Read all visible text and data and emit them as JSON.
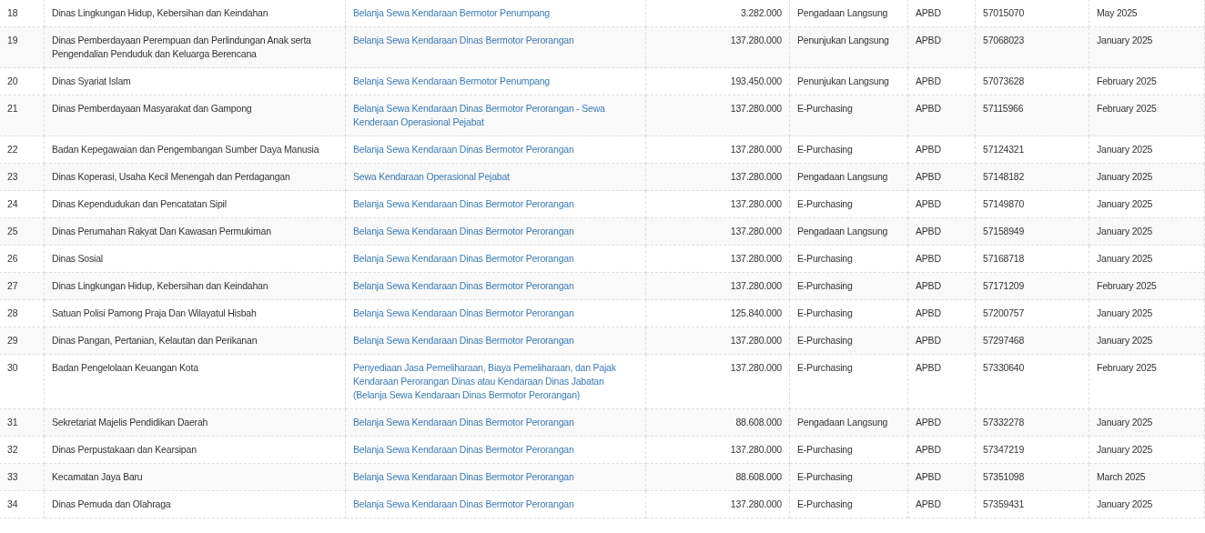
{
  "table": {
    "rows": [
      {
        "no": "18",
        "unit": "Dinas Lingkungan Hidup, Kebersihan dan Keindahan",
        "package": "Belanja Sewa Kendaraan Bermotor Penumpang",
        "budget": "3.282.000",
        "method": "Pengadaan Langsung",
        "source": "APBD",
        "code": "57015070",
        "time": "May 2025"
      },
      {
        "no": "19",
        "unit": "Dinas Pemberdayaan Perempuan dan Perlindungan Anak serta Pengendalian Penduduk dan Keluarga Berencana",
        "package": "Belanja Sewa Kendaraan Dinas Bermotor Perorangan",
        "budget": "137.280.000",
        "method": "Penunjukan Langsung",
        "source": "APBD",
        "code": "57068023",
        "time": "January 2025"
      },
      {
        "no": "20",
        "unit": "Dinas Syariat Islam",
        "package": "Belanja Sewa Kendaraan Bermotor Penumpang",
        "budget": "193.450.000",
        "method": "Penunjukan Langsung",
        "source": "APBD",
        "code": "57073628",
        "time": "February 2025"
      },
      {
        "no": "21",
        "unit": "Dinas Pemberdayaan Masyarakat dan Gampong",
        "package": "Belanja Sewa Kendaraan Dinas Bermotor Perorangan - Sewa Kenderaan Operasional Pejabat",
        "budget": "137.280.000",
        "method": "E-Purchasing",
        "source": "APBD",
        "code": "57115966",
        "time": "February 2025"
      },
      {
        "no": "22",
        "unit": "Badan Kepegawaian dan Pengembangan Sumber Daya Manusia",
        "package": "Belanja Sewa Kendaraan Dinas Bermotor Perorangan",
        "budget": "137.280.000",
        "method": "E-Purchasing",
        "source": "APBD",
        "code": "57124321",
        "time": "January 2025"
      },
      {
        "no": "23",
        "unit": "Dinas Koperasi, Usaha Kecil Menengah dan Perdagangan",
        "package": "Sewa Kendaraan Operasional Pejabat",
        "budget": "137.280.000",
        "method": "Pengadaan Langsung",
        "source": "APBD",
        "code": "57148182",
        "time": "January 2025"
      },
      {
        "no": "24",
        "unit": "Dinas Kependudukan dan Pencatatan Sipil",
        "package": "Belanja Sewa Kendaraan Dinas Bermotor Perorangan",
        "budget": "137.280.000",
        "method": "E-Purchasing",
        "source": "APBD",
        "code": "57149870",
        "time": "January 2025"
      },
      {
        "no": "25",
        "unit": "Dinas Perumahan Rakyat Dan Kawasan Permukiman",
        "package": "Belanja Sewa Kendaraan Dinas Bermotor Perorangan",
        "budget": "137.280.000",
        "method": "Pengadaan Langsung",
        "source": "APBD",
        "code": "57158949",
        "time": "January 2025"
      },
      {
        "no": "26",
        "unit": "Dinas Sosial",
        "package": "Belanja Sewa Kendaraan Dinas Bermotor Perorangan",
        "budget": "137.280.000",
        "method": "E-Purchasing",
        "source": "APBD",
        "code": "57168718",
        "time": "January 2025"
      },
      {
        "no": "27",
        "unit": "Dinas Lingkungan Hidup, Kebersihan dan Keindahan",
        "package": "Belanja Sewa Kendaraan Dinas Bermotor Perorangan",
        "budget": "137.280.000",
        "method": "E-Purchasing",
        "source": "APBD",
        "code": "57171209",
        "time": "February 2025"
      },
      {
        "no": "28",
        "unit": "Satuan Polisi Pamong Praja Dan Wilayatul Hisbah",
        "package": "Belanja Sewa Kendaraan Dinas Bermotor Perorangan",
        "budget": "125.840.000",
        "method": "E-Purchasing",
        "source": "APBD",
        "code": "57200757",
        "time": "January 2025"
      },
      {
        "no": "29",
        "unit": "Dinas Pangan, Pertanian, Kelautan dan Perikanan",
        "package": "Belanja Sewa Kendaraan Dinas Bermotor Perorangan",
        "budget": "137.280.000",
        "method": "E-Purchasing",
        "source": "APBD",
        "code": "57297468",
        "time": "January 2025"
      },
      {
        "no": "30",
        "unit": "Badan Pengelolaan Keuangan Kota",
        "package": "Penyediaan Jasa Pemeliharaan, Biaya Pemeliharaan, dan Pajak Kendaraan Perorangan Dinas atau Kendaraan Dinas Jabatan (Belanja Sewa Kendaraan Dinas Bermotor Perorangan)",
        "budget": "137.280.000",
        "method": "E-Purchasing",
        "source": "APBD",
        "code": "57330640",
        "time": "February 2025"
      },
      {
        "no": "31",
        "unit": "Sekretariat Majelis Pendidikan Daerah",
        "package": "Belanja Sewa Kendaraan Dinas Bermotor Perorangan",
        "budget": "88.608.000",
        "method": "Pengadaan Langsung",
        "source": "APBD",
        "code": "57332278",
        "time": "January 2025"
      },
      {
        "no": "32",
        "unit": "Dinas Perpustakaan dan Kearsipan",
        "package": "Belanja Sewa Kendaraan Dinas Bermotor Perorangan",
        "budget": "137.280.000",
        "method": "E-Purchasing",
        "source": "APBD",
        "code": "57347219",
        "time": "January 2025"
      },
      {
        "no": "33",
        "unit": "Kecamatan Jaya Baru",
        "package": "Belanja Sewa Kendaraan Dinas Bermotor Perorangan",
        "budget": "88.608.000",
        "method": "E-Purchasing",
        "source": "APBD",
        "code": "57351098",
        "time": "March 2025"
      },
      {
        "no": "34",
        "unit": "Dinas Pemuda dan Olahraga",
        "package": "Belanja Sewa Kendaraan Dinas Bermotor Perorangan",
        "budget": "137.280.000",
        "method": "E-Purchasing",
        "source": "APBD",
        "code": "57359431",
        "time": "January 2025"
      }
    ]
  }
}
